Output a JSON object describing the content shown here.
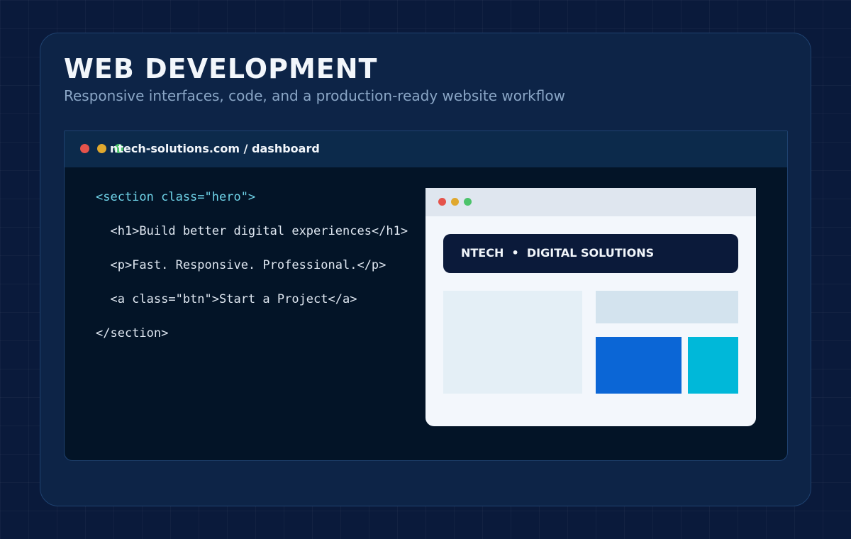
{
  "header": {
    "title": "WEB DEVELOPMENT",
    "subtitle": "Responsive interfaces, code, and a production-ready website workflow"
  },
  "browser": {
    "url": "ntech-solutions.com / dashboard",
    "window_controls": [
      "close",
      "minimize",
      "maximize"
    ]
  },
  "code": {
    "lines": [
      "<section class=\"hero\">",
      "  <h1>Build better digital experiences</h1>",
      "  <p>Fast. Responsive. Professional.</p>",
      "  <a class=\"btn\">Start a Project</a>",
      "</section>"
    ]
  },
  "preview": {
    "hero_text": "NTECH  •  DIGITAL SOLUTIONS"
  },
  "colors": {
    "background": "#0a1a3b",
    "card": "#0d2447",
    "editor": "#031427",
    "tag_accent": "#6fd3e8",
    "dot_red": "#e5534b",
    "dot_yellow": "#e0a82e",
    "dot_green": "#4cc36b",
    "block_blue": "#0b66d6",
    "block_cyan": "#00b8d9"
  }
}
